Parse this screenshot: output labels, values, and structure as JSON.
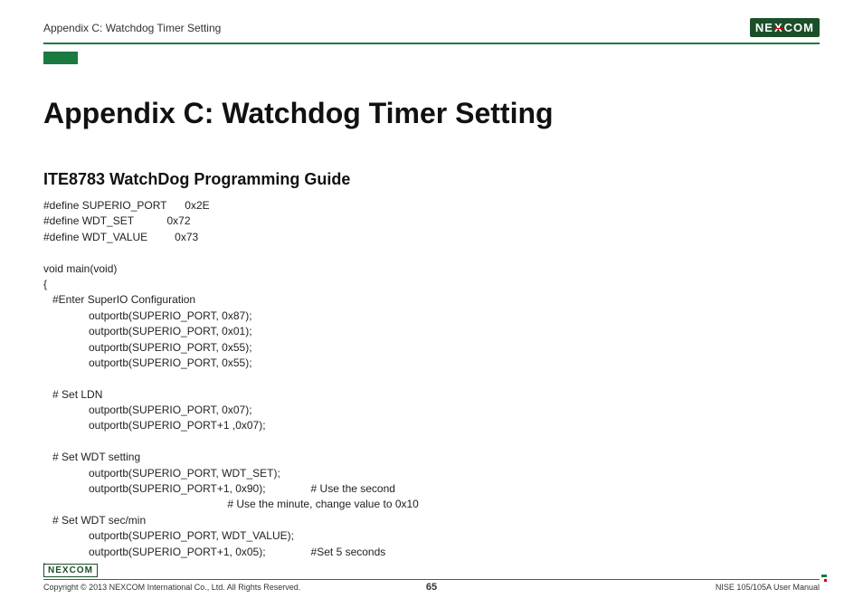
{
  "header": {
    "breadcrumb": "Appendix C: Watchdog Timer Setting",
    "logo_text_left": "NE",
    "logo_text_x": "X",
    "logo_text_right": "COM"
  },
  "page": {
    "title": "Appendix C: Watchdog Timer Setting",
    "subtitle": "ITE8783 WatchDog Programming Guide",
    "code": "#define SUPERIO_PORT      0x2E\n#define WDT_SET           0x72\n#define WDT_VALUE         0x73\n\nvoid main(void)\n{\n   #Enter SuperIO Configuration\n               outportb(SUPERIO_PORT, 0x87);\n               outportb(SUPERIO_PORT, 0x01);\n               outportb(SUPERIO_PORT, 0x55);\n               outportb(SUPERIO_PORT, 0x55);\n\n   # Set LDN\n               outportb(SUPERIO_PORT, 0x07);\n               outportb(SUPERIO_PORT+1 ,0x07);\n\n   # Set WDT setting\n               outportb(SUPERIO_PORT, WDT_SET);\n               outportb(SUPERIO_PORT+1, 0x90);               # Use the second\n                                                             # Use the minute, change value to 0x10\n   # Set WDT sec/min\n               outportb(SUPERIO_PORT, WDT_VALUE);\n               outportb(SUPERIO_PORT+1, 0x05);               #Set 5 seconds\n}"
  },
  "footer": {
    "logo_text_left": "NE",
    "logo_text_x": "X",
    "logo_text_right": "COM",
    "copyright": "Copyright © 2013 NEXCOM International Co., Ltd. All Rights Reserved.",
    "page_number": "65",
    "manual_ref": "NISE 105/105A User Manual"
  }
}
